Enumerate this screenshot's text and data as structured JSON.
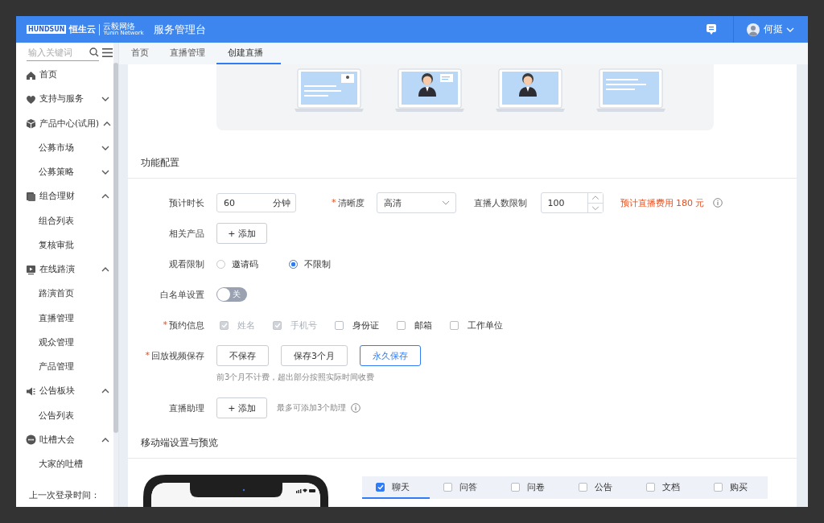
{
  "header": {
    "logo_text": "HUNDSUN",
    "brand": "恒生云",
    "partner": "云毅网络",
    "partner_en": "Yunin Network",
    "title": "服务管理台",
    "user": "何挺"
  },
  "sidebar": {
    "search": {
      "placeholder": "输入关键词"
    },
    "items": [
      {
        "label": "首页"
      },
      {
        "label": "支持与服务",
        "expanded": false
      },
      {
        "label": "产品中心(试用)",
        "expanded": true,
        "children": [
          {
            "label": "公募市场",
            "expanded": false
          },
          {
            "label": "公募策略",
            "expanded": false
          }
        ]
      },
      {
        "label": "组合理财",
        "expanded": true,
        "children": [
          {
            "label": "组合列表"
          },
          {
            "label": "复核审批"
          }
        ]
      },
      {
        "label": "在线路演",
        "expanded": true,
        "children": [
          {
            "label": "路演首页"
          },
          {
            "label": "直播管理"
          },
          {
            "label": "观众管理"
          },
          {
            "label": "产品管理"
          }
        ]
      },
      {
        "label": "公告板块",
        "expanded": true,
        "children": [
          {
            "label": "公告列表"
          }
        ]
      },
      {
        "label": "吐槽大会",
        "expanded": true,
        "children": [
          {
            "label": "大家的吐槽"
          }
        ]
      }
    ],
    "footer": "上一次登录时间："
  },
  "tabs": [
    {
      "label": "首页",
      "selected": false
    },
    {
      "label": "直播管理",
      "selected": false
    },
    {
      "label": "创建直播",
      "selected": true
    }
  ],
  "function_config": {
    "title": "功能配置",
    "duration": {
      "label": "预计时长",
      "value": "60",
      "unit": "分钟"
    },
    "clarity": {
      "label": "清晰度",
      "required_mark": "*",
      "value": "高清"
    },
    "viewer_limit": {
      "label": "直播人数限制",
      "value": "100"
    },
    "fee_note": "预计直播费用 180 元",
    "related_products": {
      "label": "相关产品",
      "button": "+ 添加"
    },
    "watch_restriction": {
      "label": "观看限制",
      "options": [
        {
          "label": "邀请码",
          "selected": false
        },
        {
          "label": "不限制",
          "selected": true
        }
      ]
    },
    "whitelist": {
      "label": "白名单设置",
      "on": false,
      "state_text": "关"
    },
    "reservation_info": {
      "label": "预约信息",
      "required_mark": "*",
      "options": [
        {
          "label": "姓名",
          "checked": true,
          "disabled": true
        },
        {
          "label": "手机号",
          "checked": true,
          "disabled": true
        },
        {
          "label": "身份证",
          "checked": false,
          "disabled": false
        },
        {
          "label": "邮箱",
          "checked": false,
          "disabled": false
        },
        {
          "label": "工作单位",
          "checked": false,
          "disabled": false
        }
      ]
    },
    "replay_save": {
      "label": "回放视频保存",
      "required_mark": "*",
      "options": [
        {
          "label": "不保存",
          "selected": false
        },
        {
          "label": "保存3个月",
          "selected": false
        },
        {
          "label": "永久保存",
          "selected": true
        }
      ],
      "hint": "前3个月不计费，超出部分按照实际时间收费"
    },
    "assistant": {
      "label": "直播助理",
      "button": "+ 添加",
      "note": "最多可添加3个助理"
    }
  },
  "mobile": {
    "title": "移动端设置与预览",
    "tabs": [
      {
        "label": "聊天",
        "checked": true,
        "selected": true
      },
      {
        "label": "问答",
        "checked": false,
        "selected": false
      },
      {
        "label": "问卷",
        "checked": false,
        "selected": false
      },
      {
        "label": "公告",
        "checked": false,
        "selected": false
      },
      {
        "label": "文档",
        "checked": false,
        "selected": false
      },
      {
        "label": "购买",
        "checked": false,
        "selected": false
      }
    ]
  }
}
